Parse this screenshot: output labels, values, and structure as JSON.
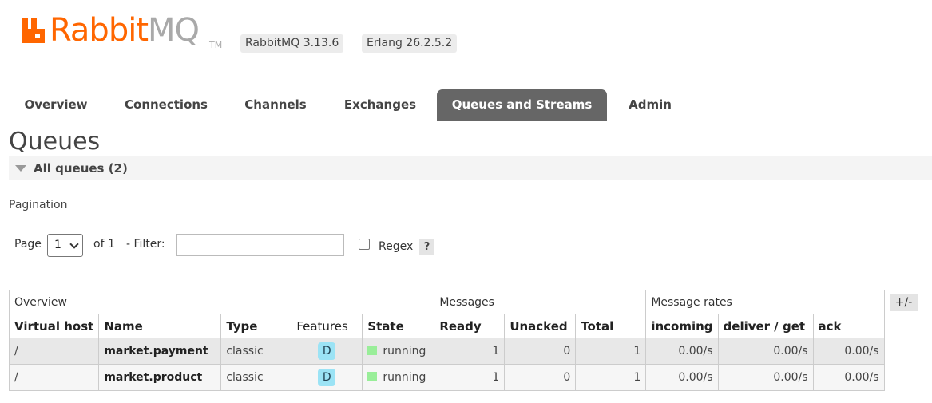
{
  "header": {
    "logo_rabbit": "Rabbit",
    "logo_mq": "MQ",
    "logo_tm": "TM",
    "version": "RabbitMQ 3.13.6",
    "erlang": "Erlang 26.2.5.2"
  },
  "tabs": [
    {
      "label": "Overview"
    },
    {
      "label": "Connections"
    },
    {
      "label": "Channels"
    },
    {
      "label": "Exchanges"
    },
    {
      "label": "Queues and Streams",
      "active": true
    },
    {
      "label": "Admin"
    }
  ],
  "page": {
    "title": "Queues",
    "section_title": "All queues (2)"
  },
  "pagination": {
    "title": "Pagination",
    "page_label": "Page",
    "page_value": "1",
    "of_label": "of 1",
    "filter_label": "- Filter:",
    "filter_value": "",
    "regex_label": "Regex",
    "help_label": "?"
  },
  "table": {
    "groups": [
      "Overview",
      "Messages",
      "Message rates"
    ],
    "columns": [
      "Virtual host",
      "Name",
      "Type",
      "Features",
      "State",
      "Ready",
      "Unacked",
      "Total",
      "incoming",
      "deliver / get",
      "ack"
    ],
    "toggle_label": "+/-",
    "rows": [
      {
        "vhost": "/",
        "name": "market.payment",
        "type": "classic",
        "feature": "D",
        "state": "running",
        "ready": "1",
        "unacked": "0",
        "total": "1",
        "incoming": "0.00/s",
        "deliver_get": "0.00/s",
        "ack": "0.00/s"
      },
      {
        "vhost": "/",
        "name": "market.product",
        "type": "classic",
        "feature": "D",
        "state": "running",
        "ready": "1",
        "unacked": "0",
        "total": "1",
        "incoming": "0.00/s",
        "deliver_get": "0.00/s",
        "ack": "0.00/s"
      }
    ]
  },
  "colors": {
    "brand": "#ff6600",
    "tab_active": "#666666",
    "feature_badge": "#9be3f5",
    "state_running": "#99ee99"
  }
}
